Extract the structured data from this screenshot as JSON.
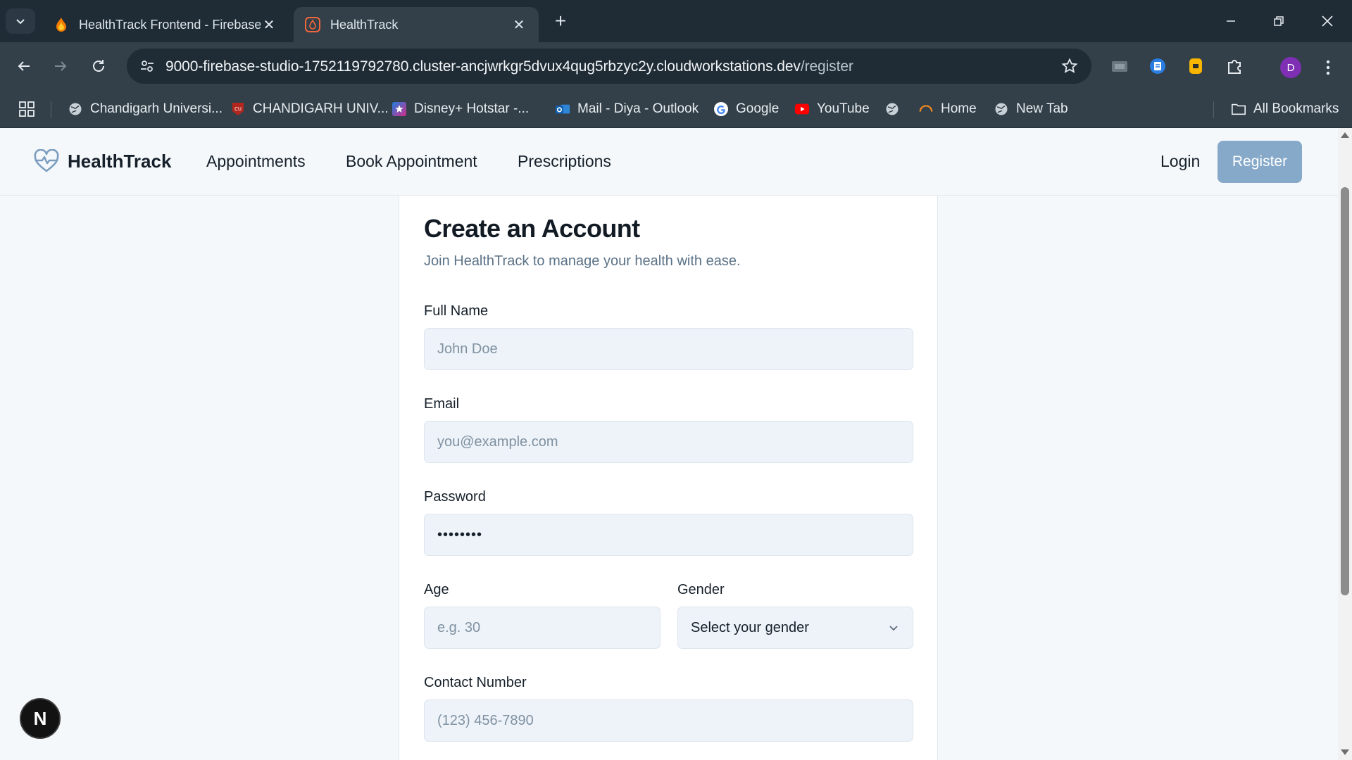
{
  "browser": {
    "tabs": [
      {
        "title": "HealthTrack Frontend - Firebase Studio",
        "icon": "firebase-icon"
      },
      {
        "title": "HealthTrack",
        "icon": "firebase-studio-icon"
      }
    ],
    "url_main": "9000-firebase-studio-1752119792780.cluster-ancjwrkgr5dvux4qug5rbzyc2y.cloudworkstations.dev",
    "url_path": "/register",
    "profile_initial": "D",
    "bookmarks": [
      {
        "label": "Chandigarh Universi...",
        "icon": "globe-icon"
      },
      {
        "label": "CHANDIGARH UNIV...",
        "icon": "cu-logo-icon"
      },
      {
        "label": "Disney+ Hotstar -...",
        "icon": "hotstar-icon"
      },
      {
        "label": "Mail - Diya - Outlook",
        "icon": "outlook-icon"
      },
      {
        "label": "Google",
        "icon": "google-icon"
      },
      {
        "label": "YouTube",
        "icon": "youtube-icon"
      },
      {
        "label": "",
        "icon": "globe-icon"
      },
      {
        "label": "Home",
        "icon": "home-arc-icon"
      },
      {
        "label": "New Tab",
        "icon": "globe-icon"
      }
    ],
    "all_bookmarks": "All Bookmarks"
  },
  "site": {
    "brand": "HealthTrack",
    "nav": [
      "Appointments",
      "Book Appointment",
      "Prescriptions"
    ],
    "login": "Login",
    "register": "Register"
  },
  "form": {
    "title": "Create an Account",
    "subtitle": "Join HealthTrack to manage your health with ease.",
    "full_name": {
      "label": "Full Name",
      "placeholder": "John Doe"
    },
    "email": {
      "label": "Email",
      "placeholder": "you@example.com"
    },
    "password": {
      "label": "Password",
      "value": "••••••••"
    },
    "age": {
      "label": "Age",
      "placeholder": "e.g. 30"
    },
    "gender": {
      "label": "Gender",
      "value": "Select your gender"
    },
    "contact": {
      "label": "Contact Number",
      "placeholder": "(123) 456-7890"
    }
  },
  "fab_letter": "N",
  "colors": {
    "chrome_dark": "#1f2b35",
    "chrome_toolbar": "#334049",
    "page_bg": "#f4f8fb",
    "input_bg": "#edf3f9",
    "register_button": "#86a9c9",
    "heart_logo": "#7a9cbf"
  }
}
